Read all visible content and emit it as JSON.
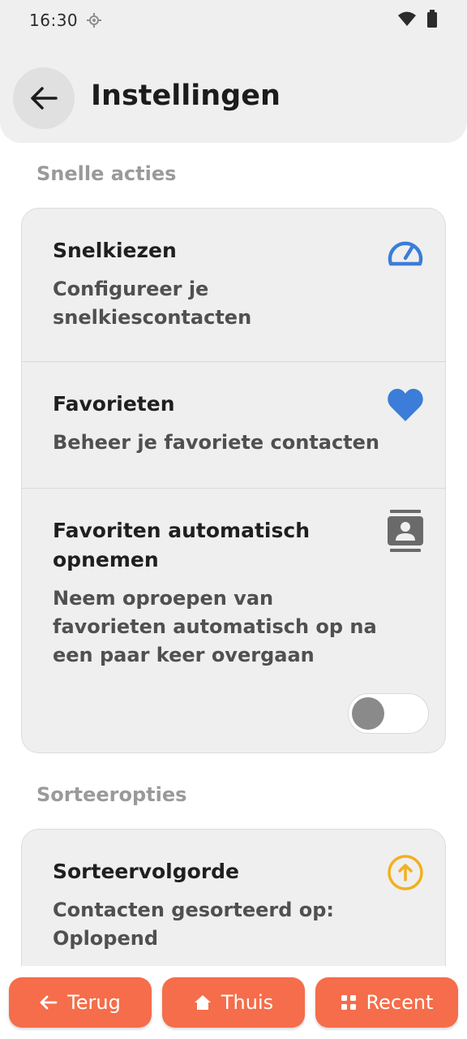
{
  "status_bar": {
    "time": "16:30",
    "icons": [
      "location-icon",
      "wifi-icon",
      "battery-icon"
    ]
  },
  "app_bar": {
    "title": "Instellingen",
    "back_icon": "arrow-left-icon"
  },
  "sections": [
    {
      "title": "Snelle acties",
      "items": [
        {
          "title": "Snelkiezen",
          "subtitle": "Configureer je snelkiescontacten",
          "icon": "speedometer-icon",
          "icon_color": "#3b7dd8"
        },
        {
          "title": "Favorieten",
          "subtitle": "Beheer je favoriete contacten",
          "icon": "heart-icon",
          "icon_color": "#3b7dd8"
        },
        {
          "title": "Favoriten automatisch opnemen",
          "subtitle": "Neem oproepen van favorieten automatisch op na een paar keer overgaan",
          "icon": "contact-card-icon",
          "icon_color": "#6a6a6a",
          "toggle_on": false
        }
      ]
    },
    {
      "title": "Sorteeropties",
      "items": [
        {
          "title": "Sorteervolgorde",
          "subtitle": "Contacten gesorteerd op: Oplopend",
          "icon": "arrow-up-circle-icon",
          "icon_color": "#f2b01e"
        }
      ]
    }
  ],
  "bottom_nav": {
    "back_label": "Terug",
    "home_label": "Thuis",
    "recent_label": "Recent",
    "accent": "#f56d4a"
  }
}
